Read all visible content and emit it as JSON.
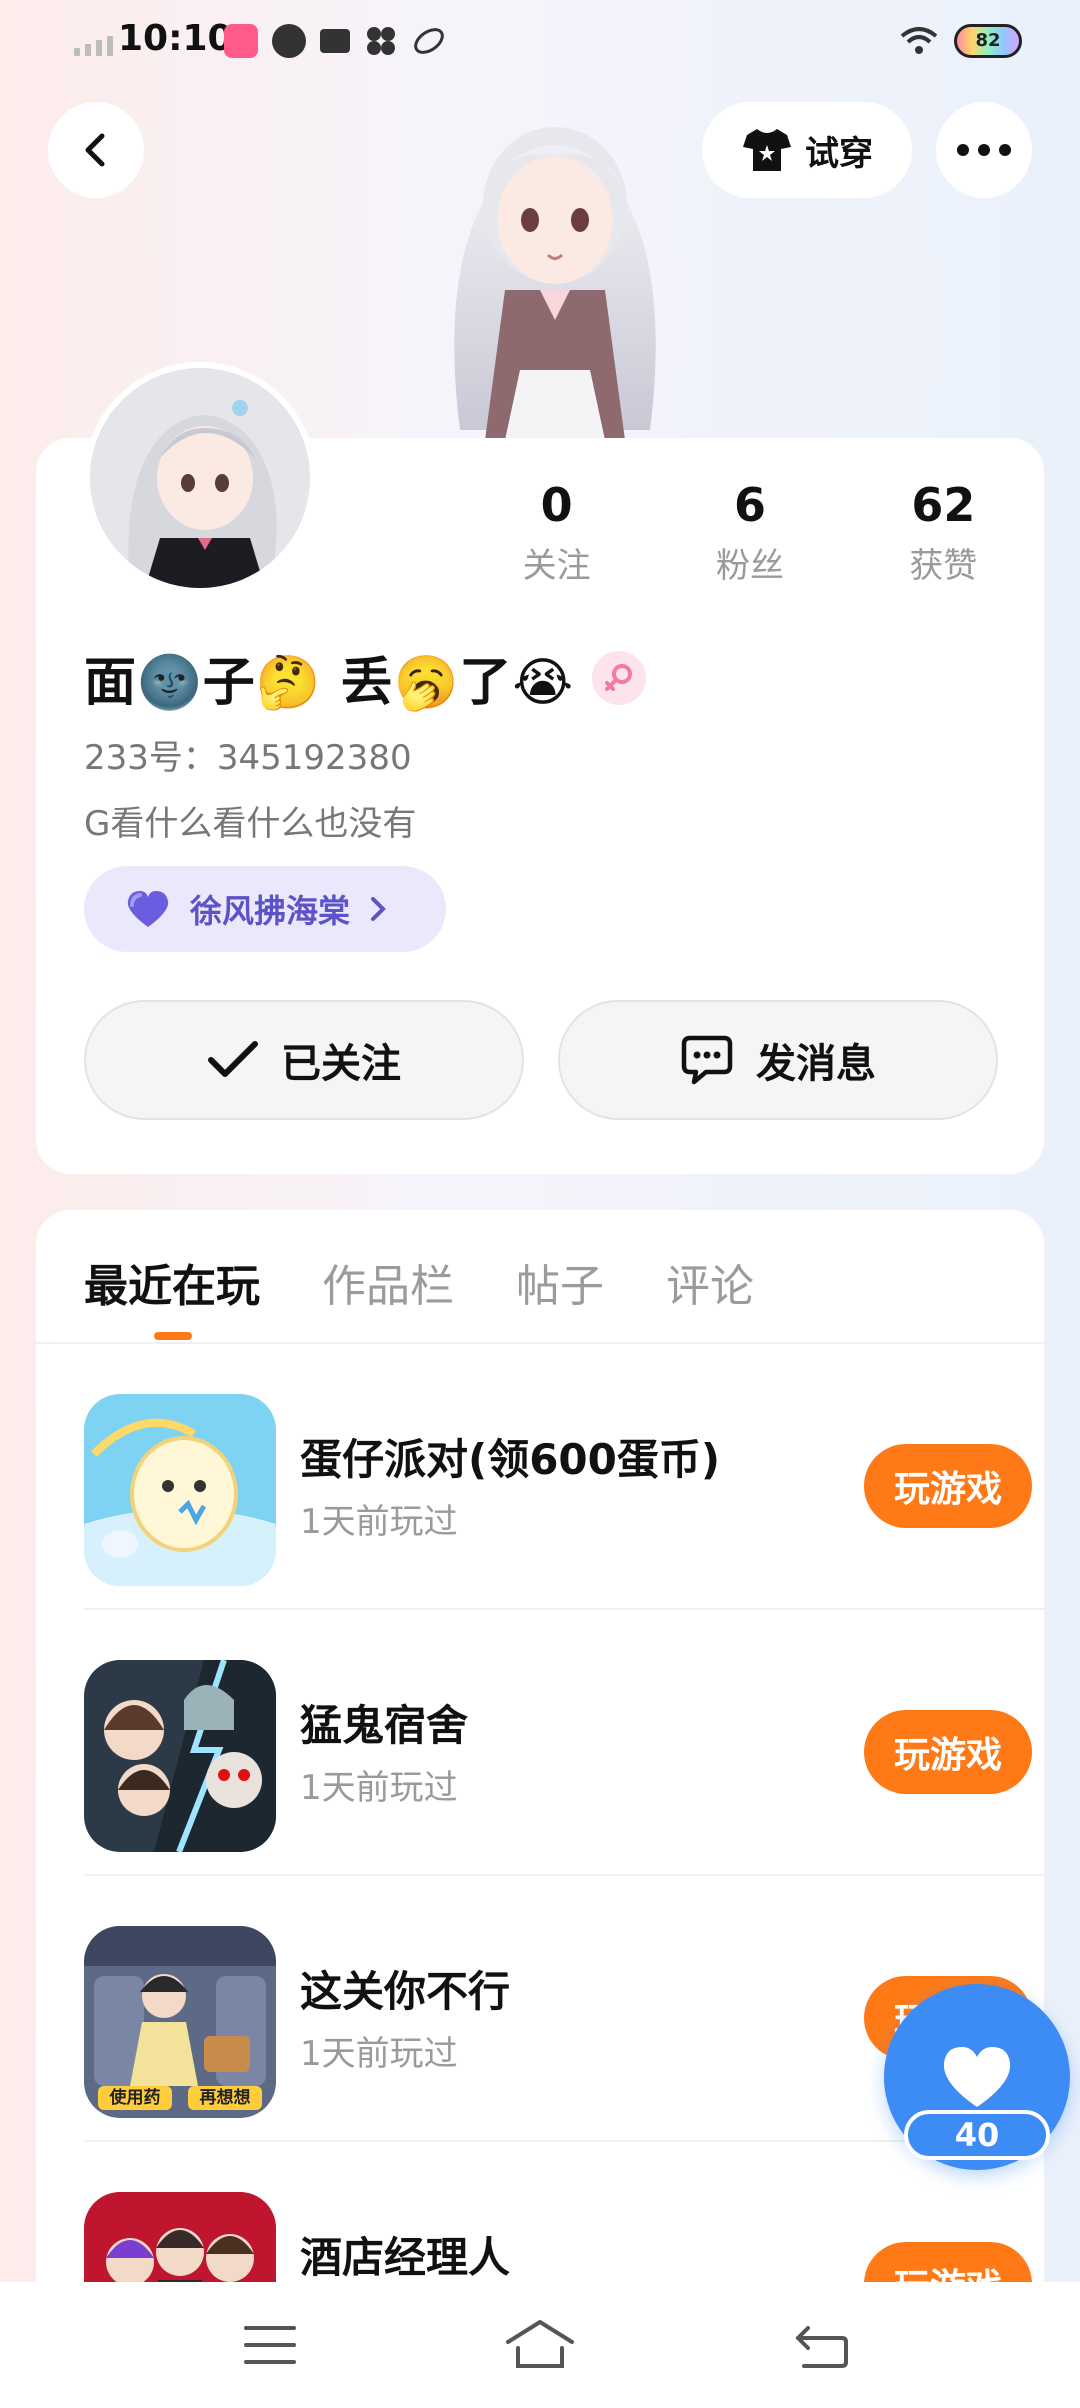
{
  "status_bar": {
    "time": "10:10",
    "battery": "82",
    "icons": [
      "signal-icon",
      "app-notification-icon",
      "play-icon",
      "video-icon",
      "pinwheel-icon",
      "leaf-icon",
      "wifi-icon",
      "battery-icon"
    ]
  },
  "header": {
    "tryon_label": "试穿",
    "icons": [
      "back-icon",
      "tshirt-icon",
      "more-icon"
    ]
  },
  "profile": {
    "stats": [
      {
        "value": "0",
        "label": "关注"
      },
      {
        "value": "6",
        "label": "粉丝"
      },
      {
        "value": "62",
        "label": "获赞"
      }
    ],
    "name": "面🌚子🤔 丢🥱了😭",
    "uid": "233号：345192380",
    "bio": "G看什么看什么也没有",
    "tag": "徐风拂海棠",
    "follow_label": "已关注",
    "message_label": "发消息"
  },
  "tabs": [
    "最近在玩",
    "作品栏",
    "帖子",
    "评论"
  ],
  "games": [
    {
      "name": "蛋仔派对(领600蛋币)",
      "sub": "1天前玩过",
      "button": "玩游戏"
    },
    {
      "name": "猛鬼宿舍",
      "sub": "1天前玩过",
      "button": "玩游戏"
    },
    {
      "name": "这关你不行",
      "sub": "1天前玩过",
      "button": "玩游戏"
    },
    {
      "name": "酒店经理人",
      "sub": "",
      "button": "玩游戏"
    }
  ],
  "game3_icon_labels": [
    "使用药",
    "再想想"
  ],
  "like": {
    "count": "40"
  },
  "colors": {
    "accent": "#ff7a16",
    "like_blue": "#3d8bf4",
    "tag_text": "#5b54c8"
  }
}
